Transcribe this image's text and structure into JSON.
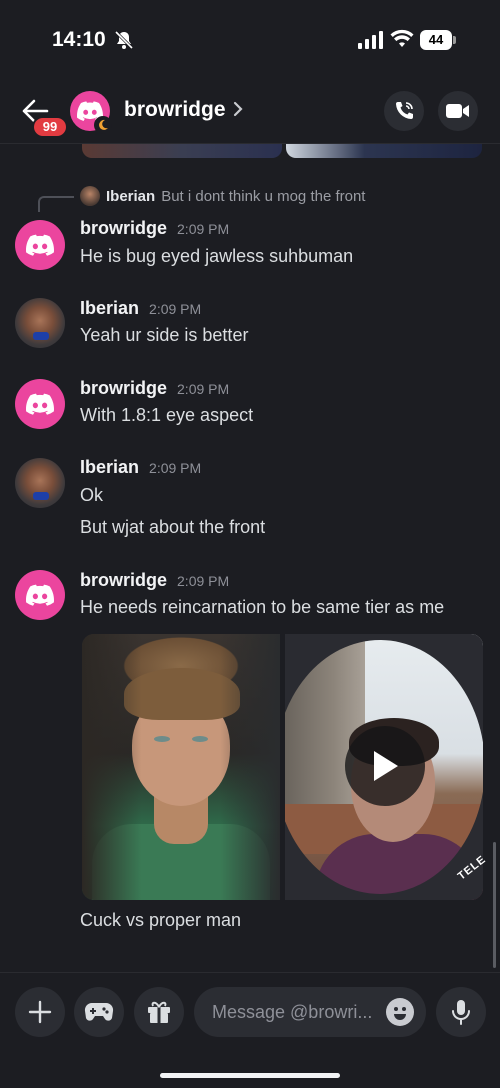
{
  "status_bar": {
    "time": "14:10",
    "battery": "44"
  },
  "header": {
    "unread_badge": "99",
    "title": "browridge"
  },
  "reply": {
    "author": "Iberian",
    "text": "But i dont think u mog the front"
  },
  "messages": [
    {
      "author": "browridge",
      "time": "2:09 PM",
      "lines": [
        "He is bug eyed jawless suhbuman"
      ]
    },
    {
      "author": "Iberian",
      "time": "2:09 PM",
      "lines": [
        "Yeah ur side is better"
      ]
    },
    {
      "author": "browridge",
      "time": "2:09 PM",
      "lines": [
        "With 1.8:1 eye aspect"
      ]
    },
    {
      "author": "Iberian",
      "time": "2:09 PM",
      "lines": [
        "Ok",
        "But wjat about the front"
      ]
    },
    {
      "author": "browridge",
      "time": "2:09 PM",
      "lines": [
        "He needs reincarnation to be same tier as me"
      ]
    }
  ],
  "attachment_caption": "Cuck vs proper man",
  "video_watermark": "TELE",
  "composer": {
    "placeholder": "Message @browri..."
  },
  "colors": {
    "accent_avatar": "#eb459e",
    "badge": "#e23b41",
    "background": "#1c1d22"
  },
  "icons": [
    "bell-slash-icon",
    "signal-icon",
    "wifi-icon",
    "back-arrow-icon",
    "discord-logo-icon",
    "moon-icon",
    "chevron-right-icon",
    "phone-icon",
    "video-camera-icon",
    "play-icon",
    "plus-icon",
    "gamepad-icon",
    "gift-icon",
    "emoji-icon",
    "microphone-icon"
  ]
}
